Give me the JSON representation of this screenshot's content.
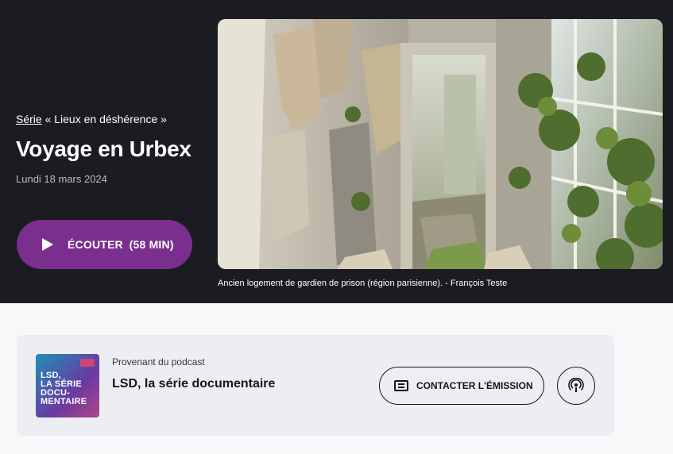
{
  "hero": {
    "series_link": "Série",
    "series_name": "« Lieux en déshérence »",
    "title": "Voyage en Urbex",
    "date": "Lundi 18 mars 2024",
    "listen_label": "ÉCOUTER",
    "listen_duration": "(58 MIN)",
    "image_caption": "Ancien logement de gardien de prison (région parisienne). - François Teste"
  },
  "podcast": {
    "provenant_label": "Provenant du podcast",
    "name": "LSD, la série documentaire",
    "cover_text": [
      "LSD,",
      "LA SÉRIE",
      "DOCU-",
      "MENTAIRE"
    ],
    "contact_label": "CONTACTER L'ÉMISSION",
    "subscribe_icon": "podcast-icon"
  },
  "colors": {
    "hero_background": "#1b1c22",
    "listen_button": "#7a2f8e",
    "card_background": "#eceef1"
  }
}
